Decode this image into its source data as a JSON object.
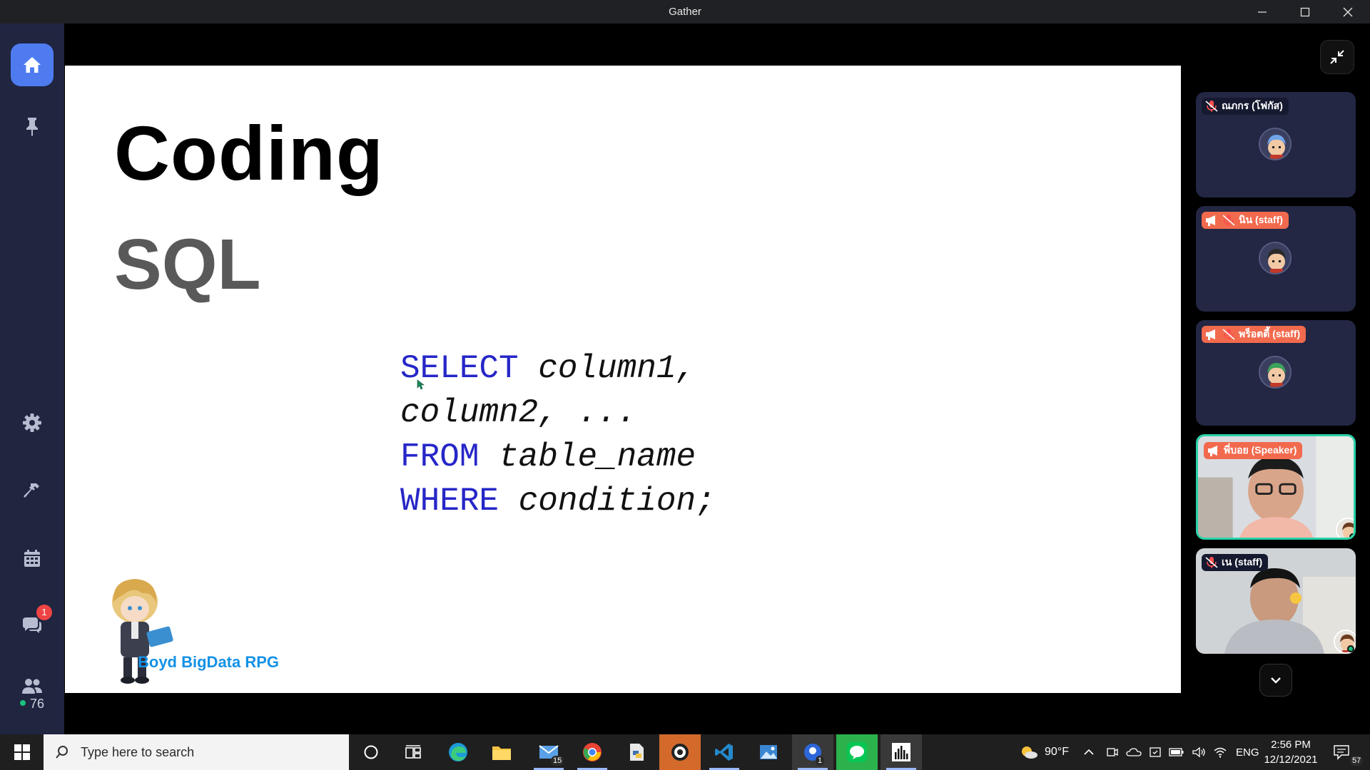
{
  "window": {
    "title": "Gather"
  },
  "sidebar": {
    "chat_badge": "1",
    "online_count": "76"
  },
  "slide": {
    "title": "Coding",
    "subtitle": "SQL",
    "code_lines": [
      [
        {
          "kw": "SELECT"
        },
        {
          "id": " column1,"
        }
      ],
      [
        {
          "id": "column2, ..."
        }
      ],
      [
        {
          "kw": "FROM"
        },
        {
          "id": " table_name"
        }
      ],
      [
        {
          "kw": "WHERE"
        },
        {
          "id": " condition;"
        }
      ]
    ],
    "brand": "Boyd BigData RPG"
  },
  "participants": [
    {
      "name": "ณภกร (โฟกัส)",
      "style": "dark",
      "muted": true,
      "megaphone": false,
      "type": "avatar"
    },
    {
      "name": "นิน (staff)",
      "style": "orange",
      "muted": true,
      "megaphone": true,
      "type": "avatar"
    },
    {
      "name": "พร็อตตี้ (staff)",
      "style": "orange",
      "muted": true,
      "megaphone": true,
      "type": "avatar"
    },
    {
      "name": "พี่บอย (Speaker)",
      "style": "orange",
      "muted": false,
      "megaphone": true,
      "type": "video"
    },
    {
      "name": "เน (staff)",
      "style": "dark",
      "muted": true,
      "megaphone": false,
      "type": "video"
    }
  ],
  "taskbar": {
    "search_placeholder": "Type here to search",
    "mail_badge": "15",
    "zoom_badge": "1",
    "weather": "90°F",
    "language": "ENG",
    "time": "2:56 PM",
    "date": "12/12/2021",
    "notifications": "57"
  },
  "colors": {
    "sidebar_bg": "#202540",
    "accent_blue": "#4e7cf0",
    "label_orange": "#f26a4e",
    "speaker_border": "#2ad3a8",
    "sql_keyword": "#2626c8",
    "brand_blue": "#1592e6"
  }
}
